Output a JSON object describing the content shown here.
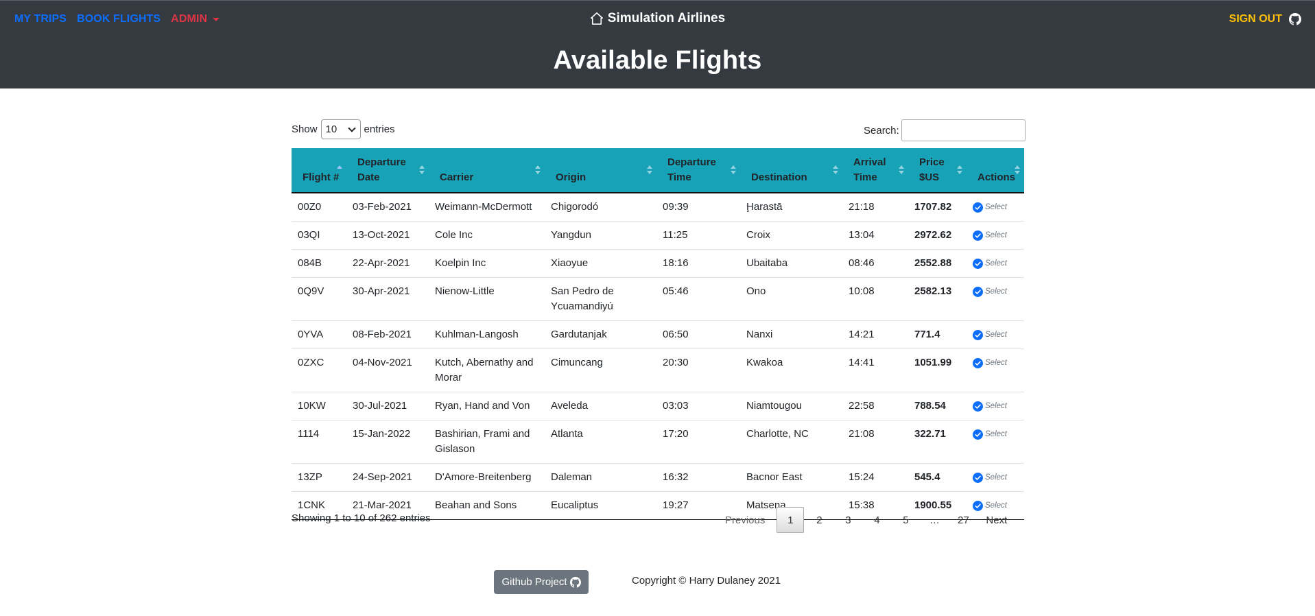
{
  "nav": {
    "my_trips": "MY TRIPS",
    "book_flights": "BOOK FLIGHTS",
    "admin": "ADMIN",
    "sign_out": "SIGN OUT"
  },
  "brand": {
    "name": "Simulation Airlines",
    "icon": "home-icon"
  },
  "page_title": "Available Flights",
  "table_controls": {
    "show_label": "Show",
    "page_length": "10",
    "entries_label": "entries",
    "search_label": "Search:",
    "search_value": ""
  },
  "table": {
    "columns": [
      "Flight #",
      "Departure Date",
      "Carrier",
      "Origin",
      "Departure Time",
      "Destination",
      "Arrival Time",
      "Price $US",
      "Actions"
    ],
    "sorted_column": "Flight #",
    "sort_direction": "ascending",
    "action_label": "Select",
    "rows": [
      {
        "flight": "00Z0",
        "date": "03-Feb-2021",
        "carrier": "Weimann-McDermott",
        "origin": "Chigorodó",
        "dep": "09:39",
        "dest": "Ḩarastā",
        "arr": "21:18",
        "price": "1707.82"
      },
      {
        "flight": "03QI",
        "date": "13-Oct-2021",
        "carrier": "Cole Inc",
        "origin": "Yangdun",
        "dep": "11:25",
        "dest": "Croix",
        "arr": "13:04",
        "price": "2972.62"
      },
      {
        "flight": "084B",
        "date": "22-Apr-2021",
        "carrier": "Koelpin Inc",
        "origin": "Xiaoyue",
        "dep": "18:16",
        "dest": "Ubaitaba",
        "arr": "08:46",
        "price": "2552.88"
      },
      {
        "flight": "0Q9V",
        "date": "30-Apr-2021",
        "carrier": "Nienow-Little",
        "origin": "San Pedro de Ycuamandiyú",
        "dep": "05:46",
        "dest": "Ono",
        "arr": "10:08",
        "price": "2582.13"
      },
      {
        "flight": "0YVA",
        "date": "08-Feb-2021",
        "carrier": "Kuhlman-Langosh",
        "origin": "Gardutanjak",
        "dep": "06:50",
        "dest": "Nanxi",
        "arr": "14:21",
        "price": "771.4"
      },
      {
        "flight": "0ZXC",
        "date": "04-Nov-2021",
        "carrier": "Kutch, Abernathy and Morar",
        "origin": "Cimuncang",
        "dep": "20:30",
        "dest": "Kwakoa",
        "arr": "14:41",
        "price": "1051.99"
      },
      {
        "flight": "10KW",
        "date": "30-Jul-2021",
        "carrier": "Ryan, Hand and Von",
        "origin": "Aveleda",
        "dep": "03:03",
        "dest": "Niamtougou",
        "arr": "22:58",
        "price": "788.54"
      },
      {
        "flight": "1114",
        "date": "15-Jan-2022",
        "carrier": "Bashirian, Frami and Gislason",
        "origin": "Atlanta",
        "dep": "17:20",
        "dest": "Charlotte, NC",
        "arr": "21:08",
        "price": "322.71"
      },
      {
        "flight": "13ZP",
        "date": "24-Sep-2021",
        "carrier": "D'Amore-Breitenberg",
        "origin": "Daleman",
        "dep": "16:32",
        "dest": "Bacnor East",
        "arr": "15:24",
        "price": "545.4"
      },
      {
        "flight": "1CNK",
        "date": "21-Mar-2021",
        "carrier": "Beahan and Sons",
        "origin": "Eucaliptus",
        "dep": "19:27",
        "dest": "Matsena",
        "arr": "15:38",
        "price": "1900.55"
      }
    ]
  },
  "info_text": "Showing 1 to 10 of 262 entries",
  "pagination": {
    "previous": "Previous",
    "pages": [
      "1",
      "2",
      "3",
      "4",
      "5",
      "…",
      "27"
    ],
    "current": "1",
    "next": "Next"
  },
  "footer": {
    "github_button": "Github Project",
    "copyright": "Copyright © Harry Dulaney 2021"
  },
  "colors": {
    "header_bg": "#343a40",
    "table_header_bg": "#17a2b8",
    "link_blue": "#0d6efd",
    "admin_red": "#dc3545",
    "signout_yellow": "#ffc107",
    "button_gray": "#6c757d"
  }
}
